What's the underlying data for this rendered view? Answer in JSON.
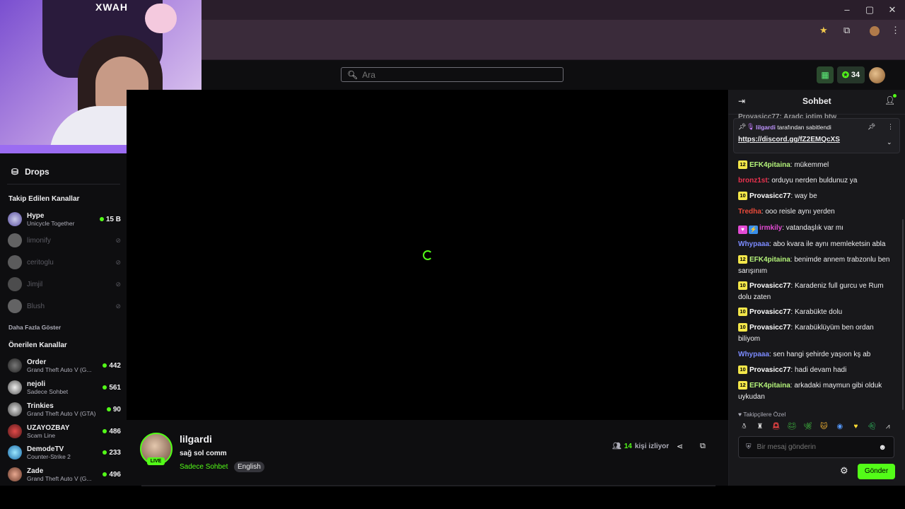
{
  "colors": {
    "accent": "#53fc18",
    "background": "#0e0e10",
    "chat_bg": "#18181b",
    "badge": "#f4e74a"
  },
  "webcam": {
    "logo": "XWAH"
  },
  "search": {
    "placeholder": "Ara"
  },
  "header": {
    "points": "34"
  },
  "sidebar": {
    "drops_label": "Drops",
    "followed_title": "Takip Edilen Kanallar",
    "show_more": "Daha Fazla Göster",
    "recommended_title": "Önerilen Kanallar",
    "followed": [
      {
        "name": "Hype",
        "category": "Unicycle Together",
        "viewers": "15 B",
        "live": true
      },
      {
        "name": "limonify",
        "live": false
      },
      {
        "name": "ceritoglu",
        "live": false
      },
      {
        "name": "Jimjil",
        "live": false
      },
      {
        "name": "Blush",
        "live": false
      }
    ],
    "recommended": [
      {
        "name": "Order",
        "category": "Grand Theft Auto V (G...",
        "viewers": "442"
      },
      {
        "name": "nejoli",
        "category": "Sadece Sohbet",
        "viewers": "561"
      },
      {
        "name": "Trinkies",
        "category": "Grand Theft Auto V (GTA)",
        "viewers": "90"
      },
      {
        "name": "UZAYOZBAY",
        "category": "Scam Line",
        "viewers": "486"
      },
      {
        "name": "DemodeTV",
        "category": "Counter-Strike 2",
        "viewers": "233"
      },
      {
        "name": "Zade",
        "category": "Grand Theft Auto V (G...",
        "viewers": "496"
      }
    ]
  },
  "stream": {
    "live_badge": "LIVE",
    "streamer": "lilgardi",
    "title": "sağ sol comm",
    "category": "Sadece Sohbet",
    "tag": "English",
    "viewer_count": "14",
    "viewer_label": "kişi izliyor"
  },
  "chat": {
    "title": "Sohbet",
    "hidden_message": "Provasicc77: Aradc iotim btw",
    "pinned": {
      "by_user": "lilgardi",
      "by_suffix": "tarafından sabitlendi",
      "link": "https://discord.gg/fZ2EMQcXS"
    },
    "messages": [
      {
        "badge": "12",
        "user": "EFK4pitaina",
        "color": "#b4f37a",
        "text": ": mükemmel"
      },
      {
        "badge": "",
        "user": "bronz1st",
        "color": "#e9324e",
        "text": ": orduyu nerden buldunuz ya"
      },
      {
        "badge": "10",
        "user": "Provasicc77",
        "color": "#ffffff",
        "text": ": way be"
      },
      {
        "badge": "",
        "user": "Tredha",
        "color": "#e94a3a",
        "text": ": ooo reisle aynı yerden"
      },
      {
        "badge": "",
        "user": "irmkily",
        "color": "#e34bd4",
        "text": ": vatandaşlık var mı",
        "icons": true
      },
      {
        "badge": "",
        "user": "Whypaaa",
        "color": "#7c8bff",
        "text": ": abo kvara ile aynı memleketsin abla"
      },
      {
        "badge": "12",
        "user": "EFK4pitaina",
        "color": "#b4f37a",
        "text": ": benimde annem trabzonlu ben sarışınım"
      },
      {
        "badge": "10",
        "user": "Provasicc77",
        "color": "#ffffff",
        "text": ": Karadeniz full gurcu ve Rum dolu zaten"
      },
      {
        "badge": "10",
        "user": "Provasicc77",
        "color": "#ffffff",
        "text": ": Karabükte dolu"
      },
      {
        "badge": "10",
        "user": "Provasicc77",
        "color": "#ffffff",
        "text": ": Karabüklüyüm ben ordan biliyom"
      },
      {
        "badge": "",
        "user": "Whypaaa",
        "color": "#7c8bff",
        "text": ": sen hangi şehirde yaşıon kş ab"
      },
      {
        "badge": "10",
        "user": "Provasicc77",
        "color": "#ffffff",
        "text": ": hadi devam hadi"
      },
      {
        "badge": "12",
        "user": "EFK4pitaina",
        "color": "#b4f37a",
        "text": ": arkadaki maymun gibi olduk uykudan"
      }
    ],
    "fav_label": "Takipçilere Özel",
    "input_placeholder": "Bir mesaj gönderin",
    "send_label": "Gönder"
  }
}
